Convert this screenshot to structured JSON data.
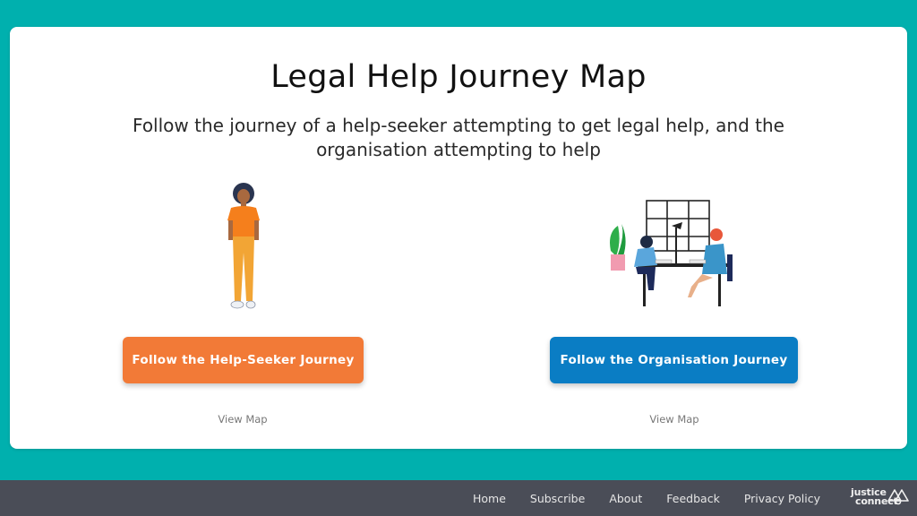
{
  "page": {
    "title": "Legal Help Journey Map",
    "subtitle": "Follow the journey of a help-seeker attempting to get legal help, and the organisation attempting to help"
  },
  "journeys": [
    {
      "illustration": "help-seeker-illustration",
      "button_label": "Follow the Help-Seeker Journey",
      "link_label": "View Map",
      "color": "#f27a37"
    },
    {
      "illustration": "organisation-office-illustration",
      "button_label": "Follow the Organisation Journey",
      "link_label": "View Map",
      "color": "#0a7dc4"
    }
  ],
  "footer": {
    "nav": [
      "Home",
      "Subscribe",
      "About",
      "Feedback",
      "Privacy Policy"
    ],
    "logo": {
      "line1": "justice",
      "line2": "connect"
    }
  },
  "colors": {
    "background": "#00b0ae",
    "footer": "#4a4d57"
  }
}
